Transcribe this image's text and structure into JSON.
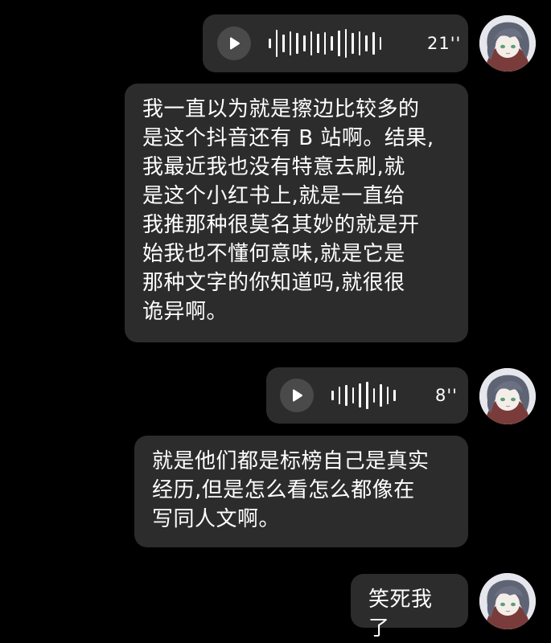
{
  "messages": [
    {
      "kind": "voice",
      "duration": "21''"
    },
    {
      "kind": "text",
      "text": "我一直以为就是擦边比较多的\n是这个抖音还有 B 站啊。结果,\n我最近我也没有特意去刷,就\n是这个小红书上,就是一直给\n我推那种很莫名其妙的就是开\n始我也不懂何意味,就是它是\n那种文字的你知道吗,就很很\n诡异啊。"
    },
    {
      "kind": "voice",
      "duration": "8''"
    },
    {
      "kind": "text",
      "text": "就是他们都是标榜自己是真实\n经历,但是怎么看怎么都像在\n写同人文啊。"
    },
    {
      "kind": "text",
      "text": "笑死我了"
    }
  ],
  "avatar_icon": "anime-girl-avatar-icon",
  "play_icon": "play-icon",
  "colors": {
    "background": "#000000",
    "bubble": "#2c2c2c",
    "play_button": "#4a4a4a",
    "text": "#ffffff"
  }
}
